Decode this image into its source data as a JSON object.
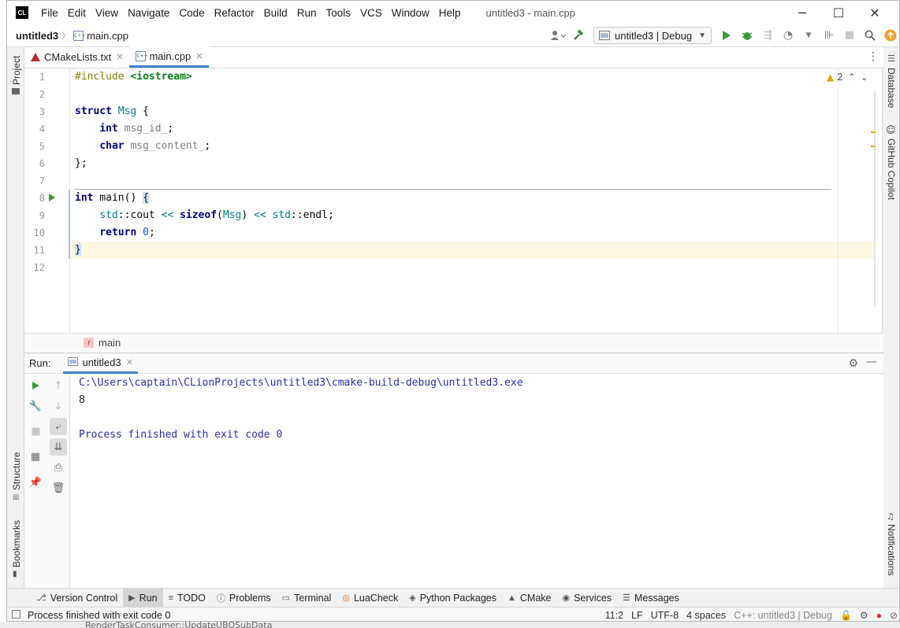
{
  "window": {
    "title": "untitled3 - main.cpp",
    "logo_text": "CL",
    "minimize": "─",
    "maximize": "☐",
    "close": "✕"
  },
  "menu": [
    "File",
    "Edit",
    "View",
    "Navigate",
    "Code",
    "Refactor",
    "Build",
    "Run",
    "Tools",
    "VCS",
    "Window",
    "Help"
  ],
  "navbar": {
    "project": "untitled3",
    "file": "main.cpp",
    "file_icon_text": "C++",
    "run_config": "untitled3 | Debug"
  },
  "editor_tabs": [
    {
      "label": "CMakeLists.txt",
      "icon": "cmake-icon",
      "active": false
    },
    {
      "label": "main.cpp",
      "icon": "cpp-file-icon",
      "active": true
    }
  ],
  "editor": {
    "warning_count": "2",
    "line_numbers": [
      "1",
      "2",
      "3",
      "4",
      "5",
      "6",
      "7",
      "8",
      "9",
      "10",
      "11",
      "12"
    ],
    "current_line": 11
  },
  "breadcrumb": {
    "function": "main",
    "badge": "f"
  },
  "run_panel": {
    "label": "Run:",
    "tab": "untitled3",
    "console": [
      "C:\\Users\\captain\\CLionProjects\\untitled3\\cmake-build-debug\\untitled3.exe",
      "8",
      "",
      "Process finished with exit code 0"
    ]
  },
  "left_stripe": {
    "project": "Project",
    "structure": "Structure",
    "bookmarks": "Bookmarks"
  },
  "right_stripe": {
    "database": "Database",
    "copilot": "GitHub Copilot",
    "notifications": "Notifications"
  },
  "tool_windows": [
    {
      "label": "Version Control",
      "icon": "⎇"
    },
    {
      "label": "Run",
      "icon": "▶",
      "active": true
    },
    {
      "label": "TODO",
      "icon": "≡"
    },
    {
      "label": "Problems",
      "icon": "ⓘ"
    },
    {
      "label": "Terminal",
      "icon": "▭"
    },
    {
      "label": "LuaCheck",
      "icon": "◎"
    },
    {
      "label": "Python Packages",
      "icon": "◈"
    },
    {
      "label": "CMake",
      "icon": "▲"
    },
    {
      "label": "Services",
      "icon": "◉"
    },
    {
      "label": "Messages",
      "icon": "☰"
    }
  ],
  "status_bar": {
    "message": "Process finished with exit code 0",
    "position": "11:2",
    "line_ending": "LF",
    "encoding": "UTF-8",
    "indent": "4 spaces",
    "context": "C++: untitled3 | Debug"
  },
  "below_window_fragment": "RenderTaskConsumer::UpdateUBOSubData"
}
